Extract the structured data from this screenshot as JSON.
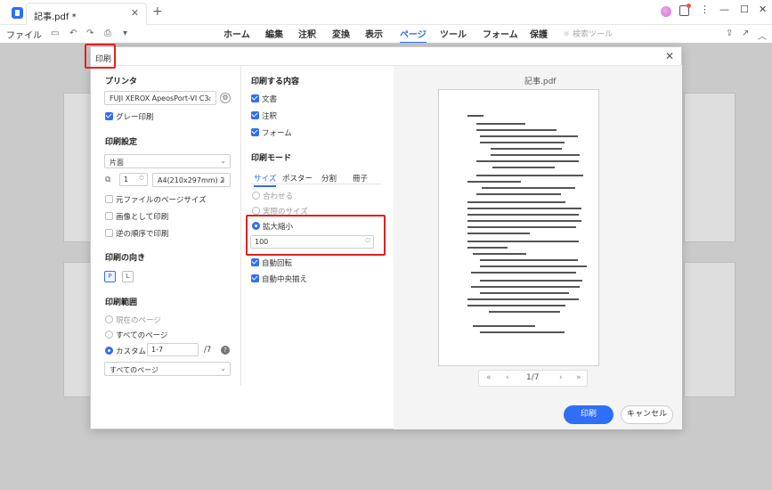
{
  "app": {
    "tab_title": "記事.pdf *",
    "tab_close": "✕",
    "tab_add": "+"
  },
  "window_controls": {
    "menu": "⋮",
    "minimize": "—",
    "maximize": "☐",
    "close": "✕"
  },
  "toolbar": {
    "file_menu": "ファイル",
    "nav_tabs": [
      "ホーム",
      "編集",
      "注釈",
      "変換",
      "表示",
      "ページ",
      "ツール",
      "フォーム",
      "保護"
    ],
    "active_tab": "ページ",
    "search_tools": "検索ツール"
  },
  "dialog": {
    "title": "印刷",
    "close": "✕",
    "printer_section": {
      "title": "プリンタ",
      "printer_name": "FUJI XEROX ApeosPort-VI C3:",
      "grayscale_label": "グレー印刷",
      "grayscale_checked": true
    },
    "print_settings": {
      "title": "印刷設定",
      "sides": "片面",
      "copies": "1",
      "paper": "A4(210x297mm) 2",
      "options": [
        {
          "label": "元ファイルのページサイズ",
          "checked": false
        },
        {
          "label": "画像として印刷",
          "checked": false
        },
        {
          "label": "逆の順序で印刷",
          "checked": false
        }
      ]
    },
    "orientation": {
      "title": "印刷の向き",
      "portrait": "P",
      "landscape": "L"
    },
    "range": {
      "title": "印刷範囲",
      "options": [
        {
          "label": "現在のページ",
          "selected": false
        },
        {
          "label": "すべてのページ",
          "selected": false
        },
        {
          "label": "カスタム",
          "selected": true
        }
      ],
      "custom_value": "1-7",
      "custom_total": "/7",
      "subset": "すべてのページ"
    },
    "content": {
      "title": "印刷する内容",
      "items": [
        {
          "label": "文書",
          "checked": true
        },
        {
          "label": "注釈",
          "checked": true
        },
        {
          "label": "フォーム",
          "checked": true
        }
      ]
    },
    "mode": {
      "title": "印刷モード",
      "tabs": [
        "サイズ",
        "ポスター",
        "分割",
        "冊子"
      ],
      "active_tab": "サイズ",
      "size_options": [
        {
          "label": "合わせる",
          "selected": false
        },
        {
          "label": "実際のサイズ",
          "selected": false
        },
        {
          "label": "拡大縮小",
          "selected": true
        }
      ],
      "scale_value": "100",
      "auto_rotate": "自動回転",
      "auto_center": "自動中央揃え"
    },
    "preview": {
      "title": "記事.pdf",
      "current_page": "1",
      "total_pages": "/7",
      "first": "«",
      "prev": "‹",
      "next": "›",
      "last": "»"
    },
    "print_button": "印刷",
    "cancel_button": "キャンセル"
  }
}
